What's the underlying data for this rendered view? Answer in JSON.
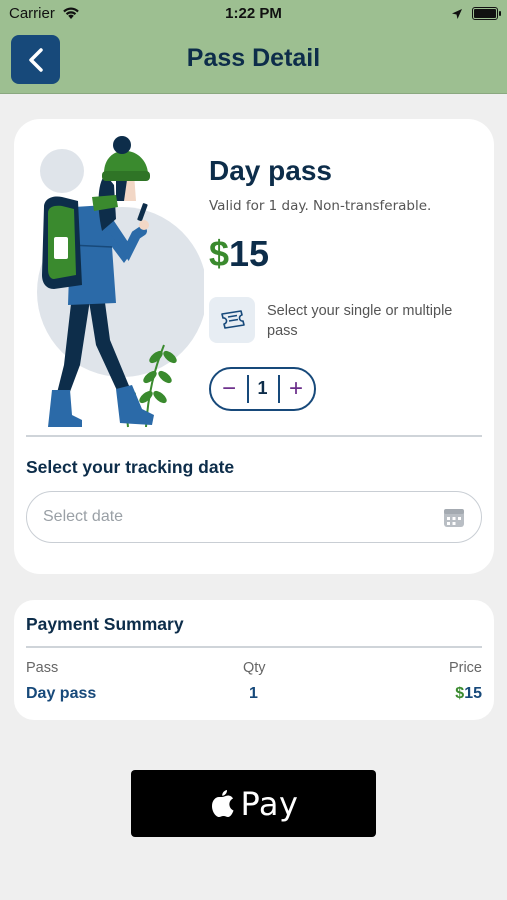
{
  "status_bar": {
    "carrier": "Carrier",
    "time": "1:22 PM"
  },
  "nav": {
    "title": "Pass Detail",
    "back_icon": "chevron-left-icon"
  },
  "pass": {
    "title": "Day pass",
    "subtitle": "Valid for 1 day. Non-transferable.",
    "currency": "$",
    "price": "15",
    "hint": "Select your single or multiple pass",
    "quantity": "1",
    "minus": "−",
    "plus": "+"
  },
  "date": {
    "label": "Select your tracking date",
    "placeholder": "Select date",
    "value": ""
  },
  "summary": {
    "title": "Payment Summary",
    "headers": {
      "pass": "Pass",
      "qty": "Qty",
      "price": "Price"
    },
    "row": {
      "pass": "Day pass",
      "qty": "1",
      "currency": "$",
      "price": "15"
    }
  },
  "apple_pay": {
    "label": "Pay"
  },
  "colors": {
    "header_bg": "#9dbf91",
    "primary": "#17497a",
    "price_accent": "#3a8a2e",
    "stepper_accent": "#6a2d8a"
  }
}
